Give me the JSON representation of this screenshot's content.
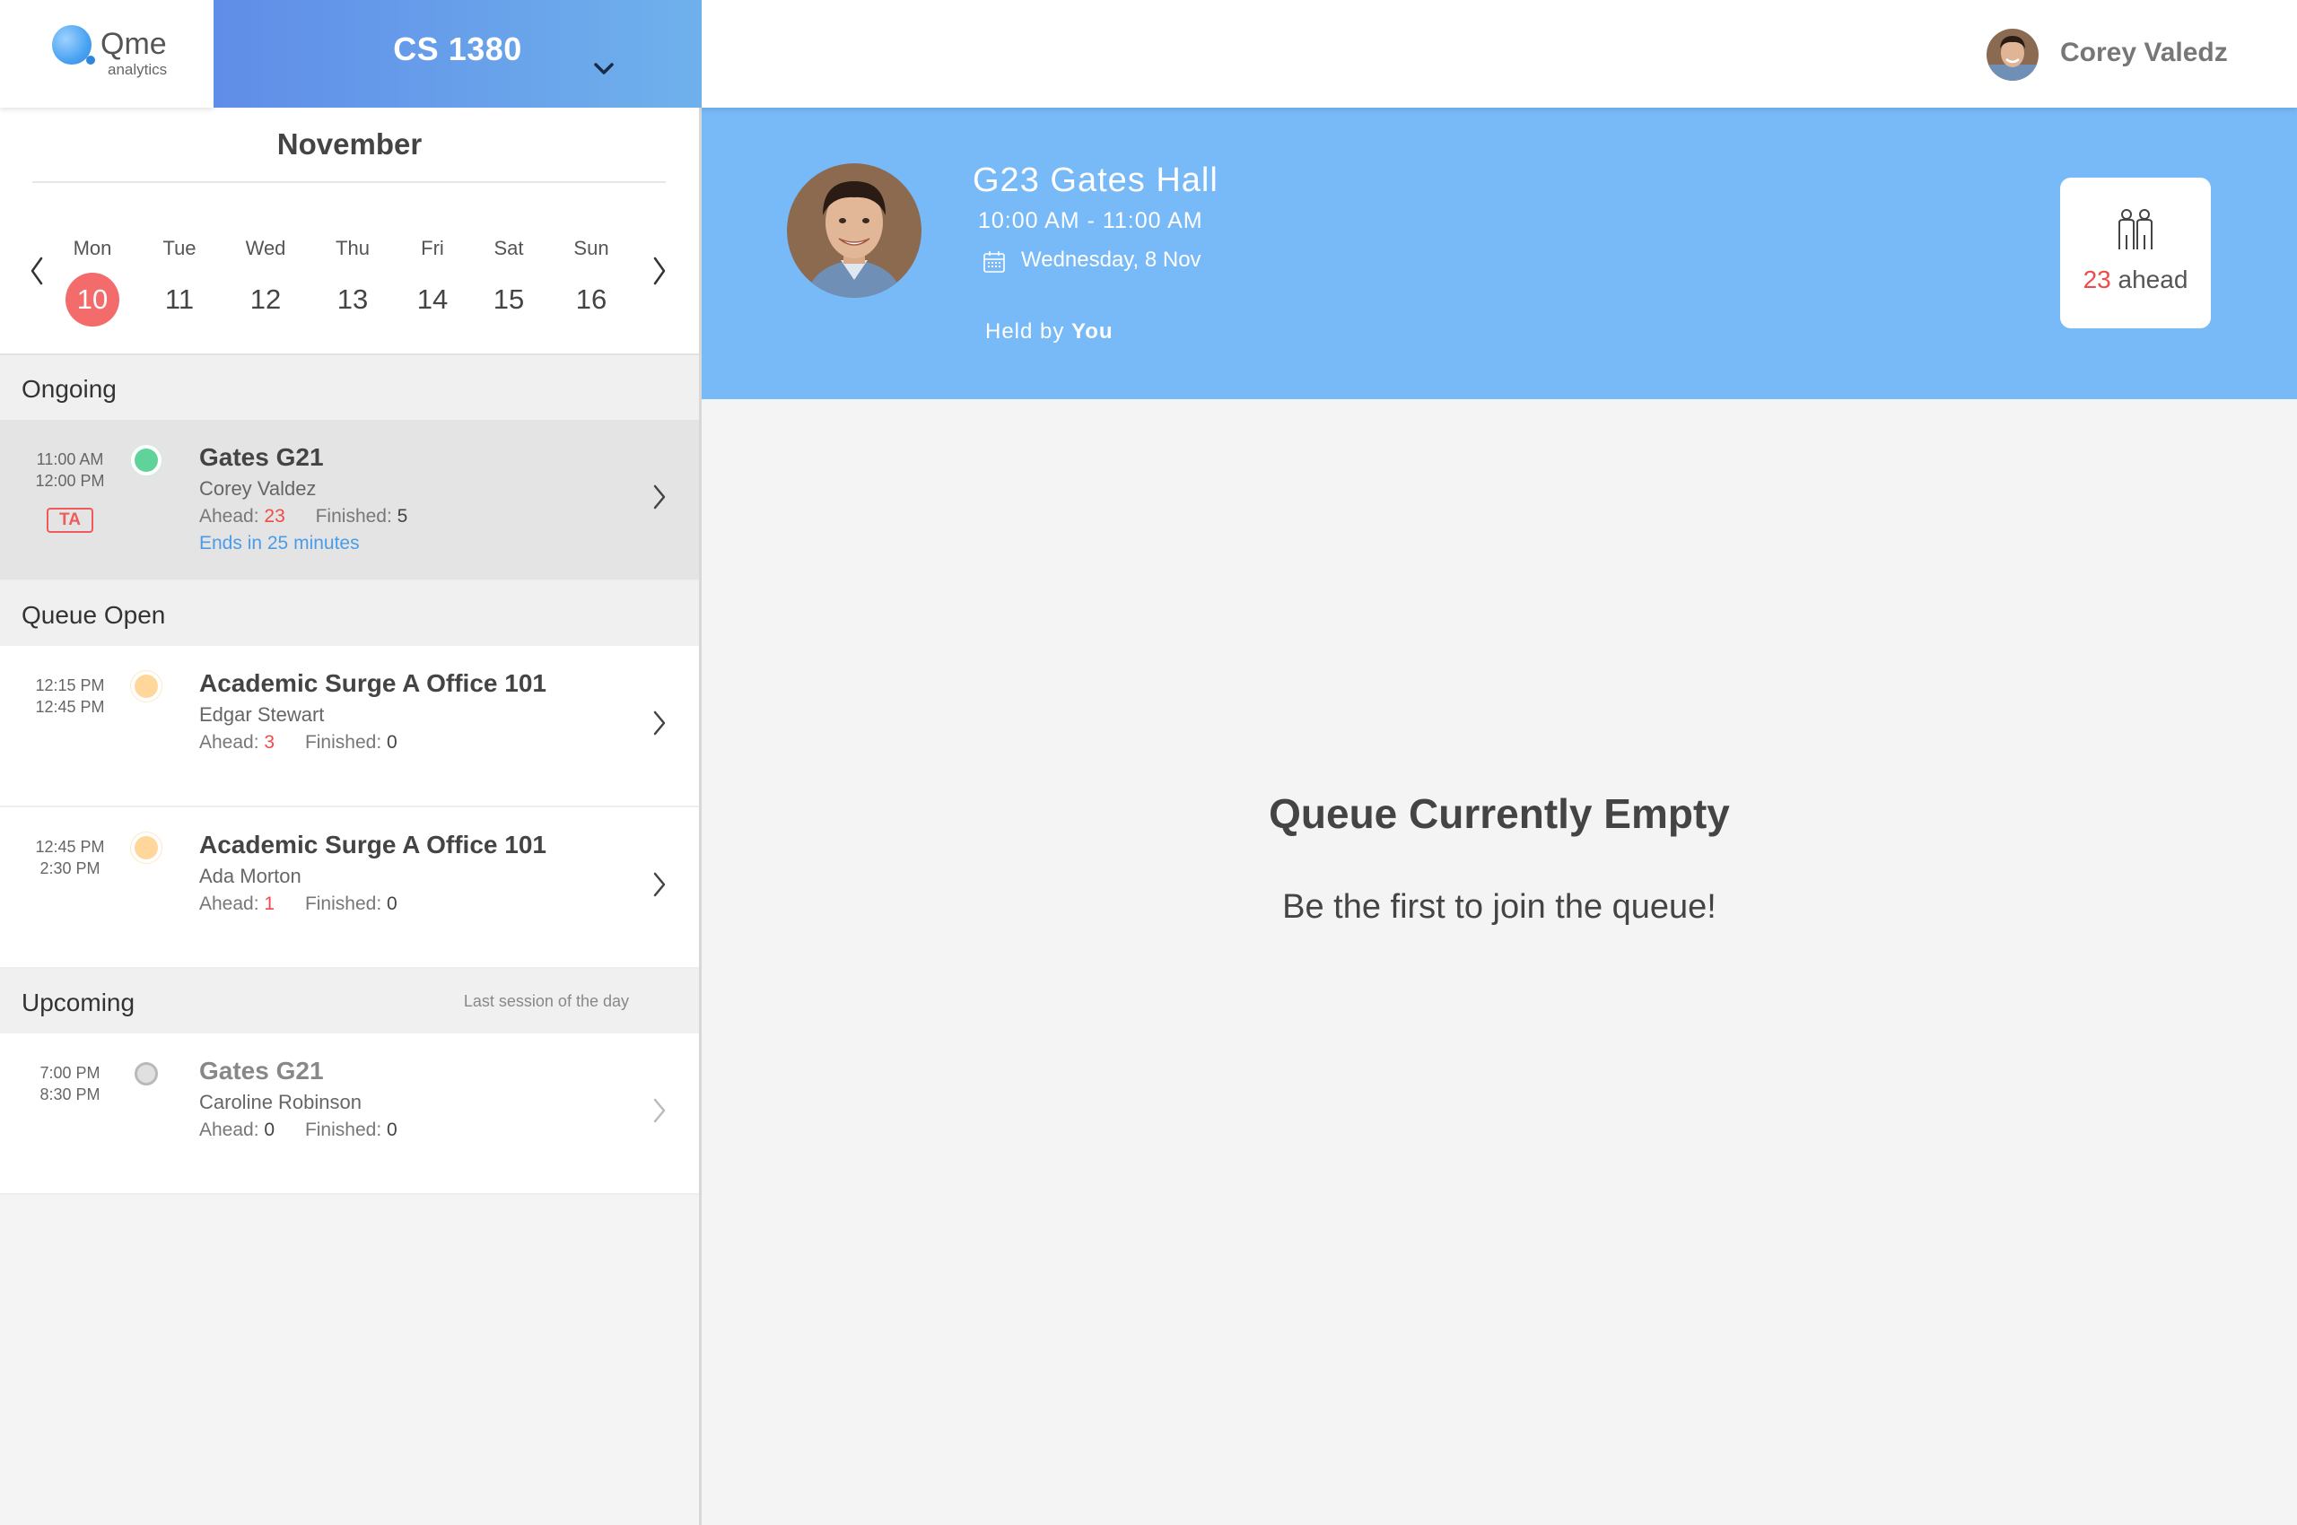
{
  "logo": {
    "word": "Qme",
    "sub": "analytics"
  },
  "course": {
    "title": "CS 1380"
  },
  "user": {
    "name": "Corey Valedz"
  },
  "calendar": {
    "month": "November",
    "days": [
      {
        "name": "Mon",
        "num": "10",
        "selected": true
      },
      {
        "name": "Tue",
        "num": "11"
      },
      {
        "name": "Wed",
        "num": "12"
      },
      {
        "name": "Thu",
        "num": "13"
      },
      {
        "name": "Fri",
        "num": "14"
      },
      {
        "name": "Sat",
        "num": "15"
      },
      {
        "name": "Sun",
        "num": "16"
      }
    ]
  },
  "sections": {
    "ongoing": "Ongoing",
    "queue_open": "Queue Open",
    "upcoming": "Upcoming",
    "upcoming_note": "Last session of the day"
  },
  "labels": {
    "ahead": "Ahead:",
    "finished": "Finished:"
  },
  "sessions": [
    {
      "start": "11:00 AM",
      "end": "12:00 PM",
      "badge": "TA",
      "title": "Gates G21",
      "person": "Corey Valdez",
      "ahead": "23",
      "finished": "5",
      "ends": "Ends in 25 minutes",
      "status": "green"
    },
    {
      "start": "12:15 PM",
      "end": "12:45 PM",
      "title": "Academic Surge A Office 101",
      "person": "Edgar Stewart",
      "ahead": "3",
      "finished": "0",
      "status": "yellow"
    },
    {
      "start": "12:45 PM",
      "end": "2:30 PM",
      "title": "Academic Surge A Office 101",
      "person": "Ada Morton",
      "ahead": "1",
      "finished": "0",
      "status": "yellow"
    },
    {
      "start": "7:00 PM",
      "end": "8:30 PM",
      "title": "Gates G21",
      "person": "Caroline Robinson",
      "ahead": "0",
      "finished": "0",
      "status": "grey"
    }
  ],
  "hero": {
    "room": "G23 Gates Hall",
    "time": "10:00 AM - 11:00 AM",
    "date": "Wednesday, 8 Nov",
    "held_prefix": "Held by",
    "held_by": "You",
    "ahead_count": "23",
    "ahead_label": "ahead"
  },
  "empty": {
    "title": "Queue Currently Empty",
    "subtitle": "Be the first to join the queue!"
  },
  "colors": {
    "accent_blue": "#78b9f8",
    "course_gradient_start": "#5f8de8",
    "course_gradient_end": "#6fb1ec",
    "selected_day": "#f36b6b",
    "alert_red": "#ef4b4b",
    "link_blue": "#4a9be8"
  },
  "icons": [
    "chevron-down-icon",
    "chevron-left-icon",
    "chevron-right-icon",
    "calendar-icon",
    "people-icon"
  ]
}
